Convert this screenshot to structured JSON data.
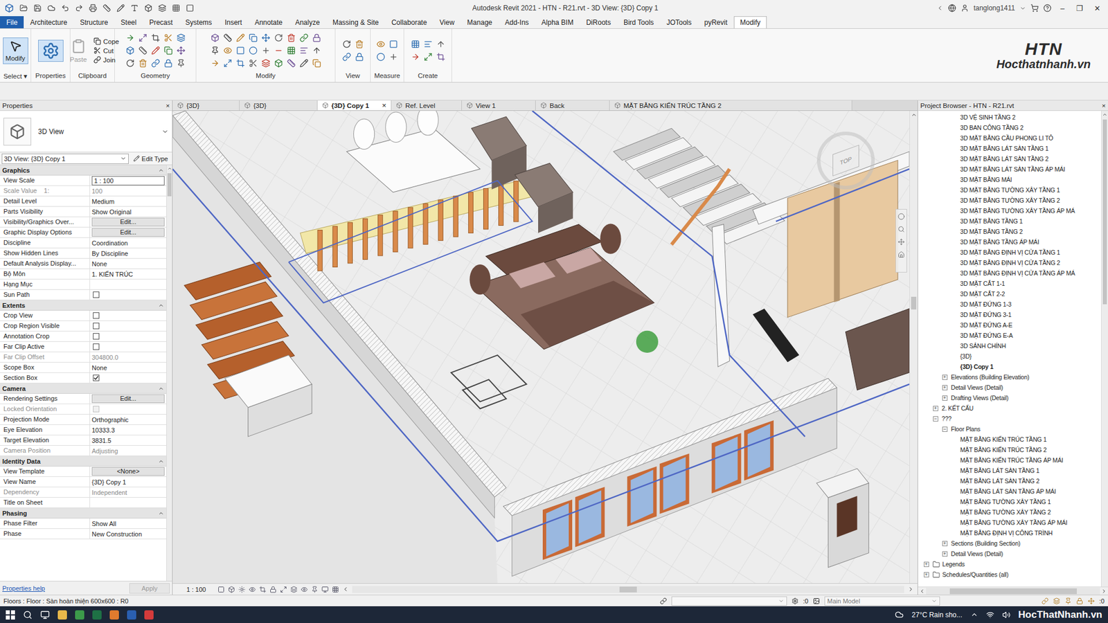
{
  "window": {
    "title": "Autodesk Revit 2021 - HTN - R21.rvt - 3D View: {3D} Copy 1",
    "user": "tanglong1411",
    "controls": [
      "–",
      "❐",
      "✕"
    ]
  },
  "ribbon": {
    "tabs": [
      {
        "label": "File",
        "selected": false
      },
      {
        "label": "Architecture",
        "selected": false
      },
      {
        "label": "Structure",
        "selected": false
      },
      {
        "label": "Steel",
        "selected": false
      },
      {
        "label": "Precast",
        "selected": false
      },
      {
        "label": "Systems",
        "selected": false
      },
      {
        "label": "Insert",
        "selected": false
      },
      {
        "label": "Annotate",
        "selected": false
      },
      {
        "label": "Analyze",
        "selected": false
      },
      {
        "label": "Massing & Site",
        "selected": false
      },
      {
        "label": "Collaborate",
        "selected": false
      },
      {
        "label": "View",
        "selected": false
      },
      {
        "label": "Manage",
        "selected": false
      },
      {
        "label": "Add-Ins",
        "selected": false
      },
      {
        "label": "Alpha BIM",
        "selected": false
      },
      {
        "label": "DiRoots",
        "selected": false
      },
      {
        "label": "Bird Tools",
        "selected": false
      },
      {
        "label": "JOTools",
        "selected": false
      },
      {
        "label": "pyRevit",
        "selected": false
      },
      {
        "label": "Modify",
        "selected": true
      }
    ],
    "panels": [
      {
        "title": "Select",
        "dropdown": "▾",
        "kind": "big-label",
        "buttons": [
          {
            "label": "Modify",
            "disabled": false
          }
        ]
      },
      {
        "title": "Properties",
        "dropdown": "",
        "kind": "big-icon",
        "buttons": []
      },
      {
        "title": "Clipboard",
        "dropdown": "",
        "kind": "clipboard",
        "buttons": [
          {
            "label": "Paste",
            "disabled": true
          },
          {
            "label": "Cope",
            "disabled": false
          },
          {
            "label": "Cut",
            "disabled": false
          },
          {
            "label": "Join",
            "disabled": false
          }
        ]
      },
      {
        "title": "Geometry",
        "dropdown": "",
        "kind": "grid",
        "buttons": []
      },
      {
        "title": "Modify",
        "dropdown": "",
        "kind": "grid",
        "buttons": []
      },
      {
        "title": "View",
        "dropdown": "",
        "kind": "grid",
        "buttons": []
      },
      {
        "title": "Measure",
        "dropdown": "",
        "kind": "grid",
        "buttons": []
      },
      {
        "title": "Create",
        "dropdown": "",
        "kind": "grid",
        "buttons": []
      }
    ]
  },
  "logo": {
    "mark": "HTN",
    "site": "Hocthatnhanh.vn"
  },
  "view_tabs": [
    {
      "label": "{3D}",
      "selected": false
    },
    {
      "label": "{3D}",
      "selected": false
    },
    {
      "label": "{3D} Copy 1",
      "selected": true
    },
    {
      "label": "Ref. Level",
      "selected": false
    },
    {
      "label": "View 1",
      "selected": false
    },
    {
      "label": "Back",
      "selected": false
    },
    {
      "label": "MẶT BẰNG KIẾN TRÚC TẦNG 2",
      "selected": false
    }
  ],
  "view_tab_close": "×",
  "properties": {
    "title": "Properties",
    "close": "×",
    "type_name": "3D View",
    "instance": "3D View: {3D} Copy 1",
    "edit_type": "Edit Type",
    "groups": [
      {
        "name": "Graphics",
        "rows": [
          {
            "label": "View Scale",
            "value": "1 : 100",
            "kind": "field",
            "disabled": false,
            "checked": false
          },
          {
            "label": "Scale Value    1:",
            "value": "100",
            "kind": "text",
            "disabled": true,
            "checked": false
          },
          {
            "label": "Detail Level",
            "value": "Medium",
            "kind": "text",
            "disabled": false,
            "checked": false
          },
          {
            "label": "Parts Visibility",
            "value": "Show Original",
            "kind": "text",
            "disabled": false,
            "checked": false
          },
          {
            "label": "Visibility/Graphics Over...",
            "value": "Edit...",
            "kind": "button",
            "disabled": false,
            "checked": false
          },
          {
            "label": "Graphic Display Options",
            "value": "Edit...",
            "kind": "button",
            "disabled": false,
            "checked": false
          },
          {
            "label": "Discipline",
            "value": "Coordination",
            "kind": "text",
            "disabled": false,
            "checked": false
          },
          {
            "label": "Show Hidden Lines",
            "value": "By Discipline",
            "kind": "text",
            "disabled": false,
            "checked": false
          },
          {
            "label": "Default Analysis Display...",
            "value": "None",
            "kind": "text",
            "disabled": false,
            "checked": false
          },
          {
            "label": "Bộ Môn",
            "value": "1. KIẾN TRÚC",
            "kind": "text",
            "disabled": false,
            "checked": false
          },
          {
            "label": "Hạng Mục",
            "value": "",
            "kind": "text",
            "disabled": false,
            "checked": false
          },
          {
            "label": "Sun Path",
            "value": "",
            "kind": "checkbox",
            "disabled": false,
            "checked": false
          }
        ]
      },
      {
        "name": "Extents",
        "rows": [
          {
            "label": "Crop View",
            "value": "",
            "kind": "checkbox",
            "disabled": false,
            "checked": false
          },
          {
            "label": "Crop Region Visible",
            "value": "",
            "kind": "checkbox",
            "disabled": false,
            "checked": false
          },
          {
            "label": "Annotation Crop",
            "value": "",
            "kind": "checkbox",
            "disabled": false,
            "checked": false
          },
          {
            "label": "Far Clip Active",
            "value": "",
            "kind": "checkbox",
            "disabled": false,
            "checked": false
          },
          {
            "label": "Far Clip Offset",
            "value": "304800.0",
            "kind": "text",
            "disabled": true,
            "checked": false
          },
          {
            "label": "Scope Box",
            "value": "None",
            "kind": "text",
            "disabled": false,
            "checked": false
          },
          {
            "label": "Section Box",
            "value": "",
            "kind": "checkbox",
            "disabled": false,
            "checked": true
          }
        ]
      },
      {
        "name": "Camera",
        "rows": [
          {
            "label": "Rendering Settings",
            "value": "Edit...",
            "kind": "button",
            "disabled": false,
            "checked": false
          },
          {
            "label": "Locked Orientation",
            "value": "",
            "kind": "checkbox",
            "disabled": true,
            "checked": false
          },
          {
            "label": "Projection Mode",
            "value": "Orthographic",
            "kind": "text",
            "disabled": false,
            "checked": false
          },
          {
            "label": "Eye Elevation",
            "value": "10333.3",
            "kind": "text",
            "disabled": false,
            "checked": false
          },
          {
            "label": "Target Elevation",
            "value": "3831.5",
            "kind": "text",
            "disabled": false,
            "checked": false
          },
          {
            "label": "Camera Position",
            "value": "Adjusting",
            "kind": "text",
            "disabled": true,
            "checked": false
          }
        ]
      },
      {
        "name": "Identity Data",
        "rows": [
          {
            "label": "View Template",
            "value": "<None>",
            "kind": "button",
            "disabled": false,
            "checked": false
          },
          {
            "label": "View Name",
            "value": "{3D} Copy 1",
            "kind": "text",
            "disabled": false,
            "checked": false
          },
          {
            "label": "Dependency",
            "value": "Independent",
            "kind": "text",
            "disabled": true,
            "checked": false
          },
          {
            "label": "Title on Sheet",
            "value": "",
            "kind": "text",
            "disabled": false,
            "checked": false
          }
        ]
      },
      {
        "name": "Phasing",
        "rows": [
          {
            "label": "Phase Filter",
            "value": "Show All",
            "kind": "text",
            "disabled": false,
            "checked": false
          },
          {
            "label": "Phase",
            "value": "New Construction",
            "kind": "text",
            "disabled": false,
            "checked": false
          }
        ]
      }
    ],
    "help": "Properties help",
    "apply": "Apply"
  },
  "viewport": {
    "viewcube": "TOP",
    "scale": "1 : 100"
  },
  "browser": {
    "title": "Project Browser - HTN - R21.rvt",
    "close": "×",
    "items": [
      {
        "label": "3D VỆ SINH TẦNG 2",
        "level": 3,
        "expander": "",
        "icon": false,
        "selected": false
      },
      {
        "label": "3D BAN CÔNG TẦNG 2",
        "level": 3,
        "expander": "",
        "icon": false,
        "selected": false
      },
      {
        "label": "3D MẶT BẰNG CẦU PHONG LI TÔ",
        "level": 3,
        "expander": "",
        "icon": false,
        "selected": false
      },
      {
        "label": "3D MẶT BẰNG LÁT SÀN TẦNG 1",
        "level": 3,
        "expander": "",
        "icon": false,
        "selected": false
      },
      {
        "label": "3D MẶT BẰNG LÁT SÀN TẦNG 2",
        "level": 3,
        "expander": "",
        "icon": false,
        "selected": false
      },
      {
        "label": "3D MẶT BẰNG LÁT SÀN TẦNG ÁP MÁI",
        "level": 3,
        "expander": "",
        "icon": false,
        "selected": false
      },
      {
        "label": "3D MẶT BẰNG MÁI",
        "level": 3,
        "expander": "",
        "icon": false,
        "selected": false
      },
      {
        "label": "3D MẶT BẰNG TƯỜNG XÂY TẦNG 1",
        "level": 3,
        "expander": "",
        "icon": false,
        "selected": false
      },
      {
        "label": "3D MẶT BẰNG TƯỜNG XÂY TẦNG 2",
        "level": 3,
        "expander": "",
        "icon": false,
        "selected": false
      },
      {
        "label": "3D MẶT BẰNG TƯỜNG XÂY TẦNG ÁP MÁ",
        "level": 3,
        "expander": "",
        "icon": false,
        "selected": false
      },
      {
        "label": "3D MẶT BẰNG TẦNG 1",
        "level": 3,
        "expander": "",
        "icon": false,
        "selected": false
      },
      {
        "label": "3D MẶT BẰNG TẦNG 2",
        "level": 3,
        "expander": "",
        "icon": false,
        "selected": false
      },
      {
        "label": "3D MẶT BẰNG TẦNG ÁP MÁI",
        "level": 3,
        "expander": "",
        "icon": false,
        "selected": false
      },
      {
        "label": "3D MẶT BẰNG ĐỊNH VỊ CỬA TẦNG 1",
        "level": 3,
        "expander": "",
        "icon": false,
        "selected": false
      },
      {
        "label": "3D MẶT BẰNG ĐỊNH VỊ CỬA TẦNG 2",
        "level": 3,
        "expander": "",
        "icon": false,
        "selected": false
      },
      {
        "label": "3D MẶT BẰNG ĐỊNH VỊ CỬA TẦNG ÁP MÁ",
        "level": 3,
        "expander": "",
        "icon": false,
        "selected": false
      },
      {
        "label": "3D MẶT CẮT 1-1",
        "level": 3,
        "expander": "",
        "icon": false,
        "selected": false
      },
      {
        "label": "3D MẶT CẮT 2-2",
        "level": 3,
        "expander": "",
        "icon": false,
        "selected": false
      },
      {
        "label": "3D MẶT ĐỨNG 1-3",
        "level": 3,
        "expander": "",
        "icon": false,
        "selected": false
      },
      {
        "label": "3D MẶT ĐỨNG 3-1",
        "level": 3,
        "expander": "",
        "icon": false,
        "selected": false
      },
      {
        "label": "3D MẶT ĐỨNG A-E",
        "level": 3,
        "expander": "",
        "icon": false,
        "selected": false
      },
      {
        "label": "3D MẶT ĐỨNG E-A",
        "level": 3,
        "expander": "",
        "icon": false,
        "selected": false
      },
      {
        "label": "3D SẢNH CHÍNH",
        "level": 3,
        "expander": "",
        "icon": false,
        "selected": false
      },
      {
        "label": "{3D}",
        "level": 3,
        "expander": "",
        "icon": false,
        "selected": false
      },
      {
        "label": "{3D} Copy 1",
        "level": 3,
        "expander": "",
        "icon": false,
        "selected": true
      },
      {
        "label": "Elevations (Building Elevation)",
        "level": 2,
        "expander": "+",
        "icon": false,
        "selected": false
      },
      {
        "label": "Detail Views (Detail)",
        "level": 2,
        "expander": "+",
        "icon": false,
        "selected": false
      },
      {
        "label": "Drafting Views (Detail)",
        "level": 2,
        "expander": "+",
        "icon": false,
        "selected": false
      },
      {
        "label": "2. KẾT CẤU",
        "level": 1,
        "expander": "+",
        "icon": false,
        "selected": false
      },
      {
        "label": "???",
        "level": 1,
        "expander": "−",
        "icon": false,
        "selected": false
      },
      {
        "label": "Floor Plans",
        "level": 2,
        "expander": "−",
        "icon": false,
        "selected": false
      },
      {
        "label": "MẶT BẰNG KIẾN TRÚC TẦNG 1",
        "level": 3,
        "expander": "",
        "icon": false,
        "selected": false
      },
      {
        "label": "MẶT BẰNG KIẾN TRÚC TẦNG 2",
        "level": 3,
        "expander": "",
        "icon": false,
        "selected": false
      },
      {
        "label": "MẶT BẰNG KIẾN TRÚC TẦNG ÁP MÁI",
        "level": 3,
        "expander": "",
        "icon": false,
        "selected": false
      },
      {
        "label": "MẶT BẰNG LÁT SÀN TẦNG 1",
        "level": 3,
        "expander": "",
        "icon": false,
        "selected": false
      },
      {
        "label": "MẶT BẰNG LÁT SÀN TẦNG 2",
        "level": 3,
        "expander": "",
        "icon": false,
        "selected": false
      },
      {
        "label": "MẶT BẰNG LÁT SÀN TẦNG ÁP MÁI",
        "level": 3,
        "expander": "",
        "icon": false,
        "selected": false
      },
      {
        "label": "MẶT BẰNG TƯỜNG XÂY TẦNG 1",
        "level": 3,
        "expander": "",
        "icon": false,
        "selected": false
      },
      {
        "label": "MẶT BẰNG TƯỜNG XÂY TẦNG 2",
        "level": 3,
        "expander": "",
        "icon": false,
        "selected": false
      },
      {
        "label": "MẶT BẰNG TƯỜNG XÂY TẦNG ÁP MÁI",
        "level": 3,
        "expander": "",
        "icon": false,
        "selected": false
      },
      {
        "label": "MẶT BẰNG ĐỊNH VỊ CÔNG TRÌNH",
        "level": 3,
        "expander": "",
        "icon": false,
        "selected": false
      },
      {
        "label": "Sections (Building Section)",
        "level": 2,
        "expander": "+",
        "icon": false,
        "selected": false
      },
      {
        "label": "Detail Views (Detail)",
        "level": 2,
        "expander": "+",
        "icon": false,
        "selected": false
      },
      {
        "label": "Legends",
        "level": 0,
        "expander": "+",
        "icon": true,
        "selected": false
      },
      {
        "label": "Schedules/Quantities (all)",
        "level": 0,
        "expander": "+",
        "icon": true,
        "selected": false
      }
    ]
  },
  "status_bar": {
    "text": "Floors : Floor : Sàn hoàn thiện 600x600 : R0",
    "worksets": ":0",
    "model": "Main Model",
    "filter_count": ":0"
  },
  "taskbar": {
    "weather": "27°C  Rain sho...",
    "brand": "HocThatNhanh.vn"
  }
}
